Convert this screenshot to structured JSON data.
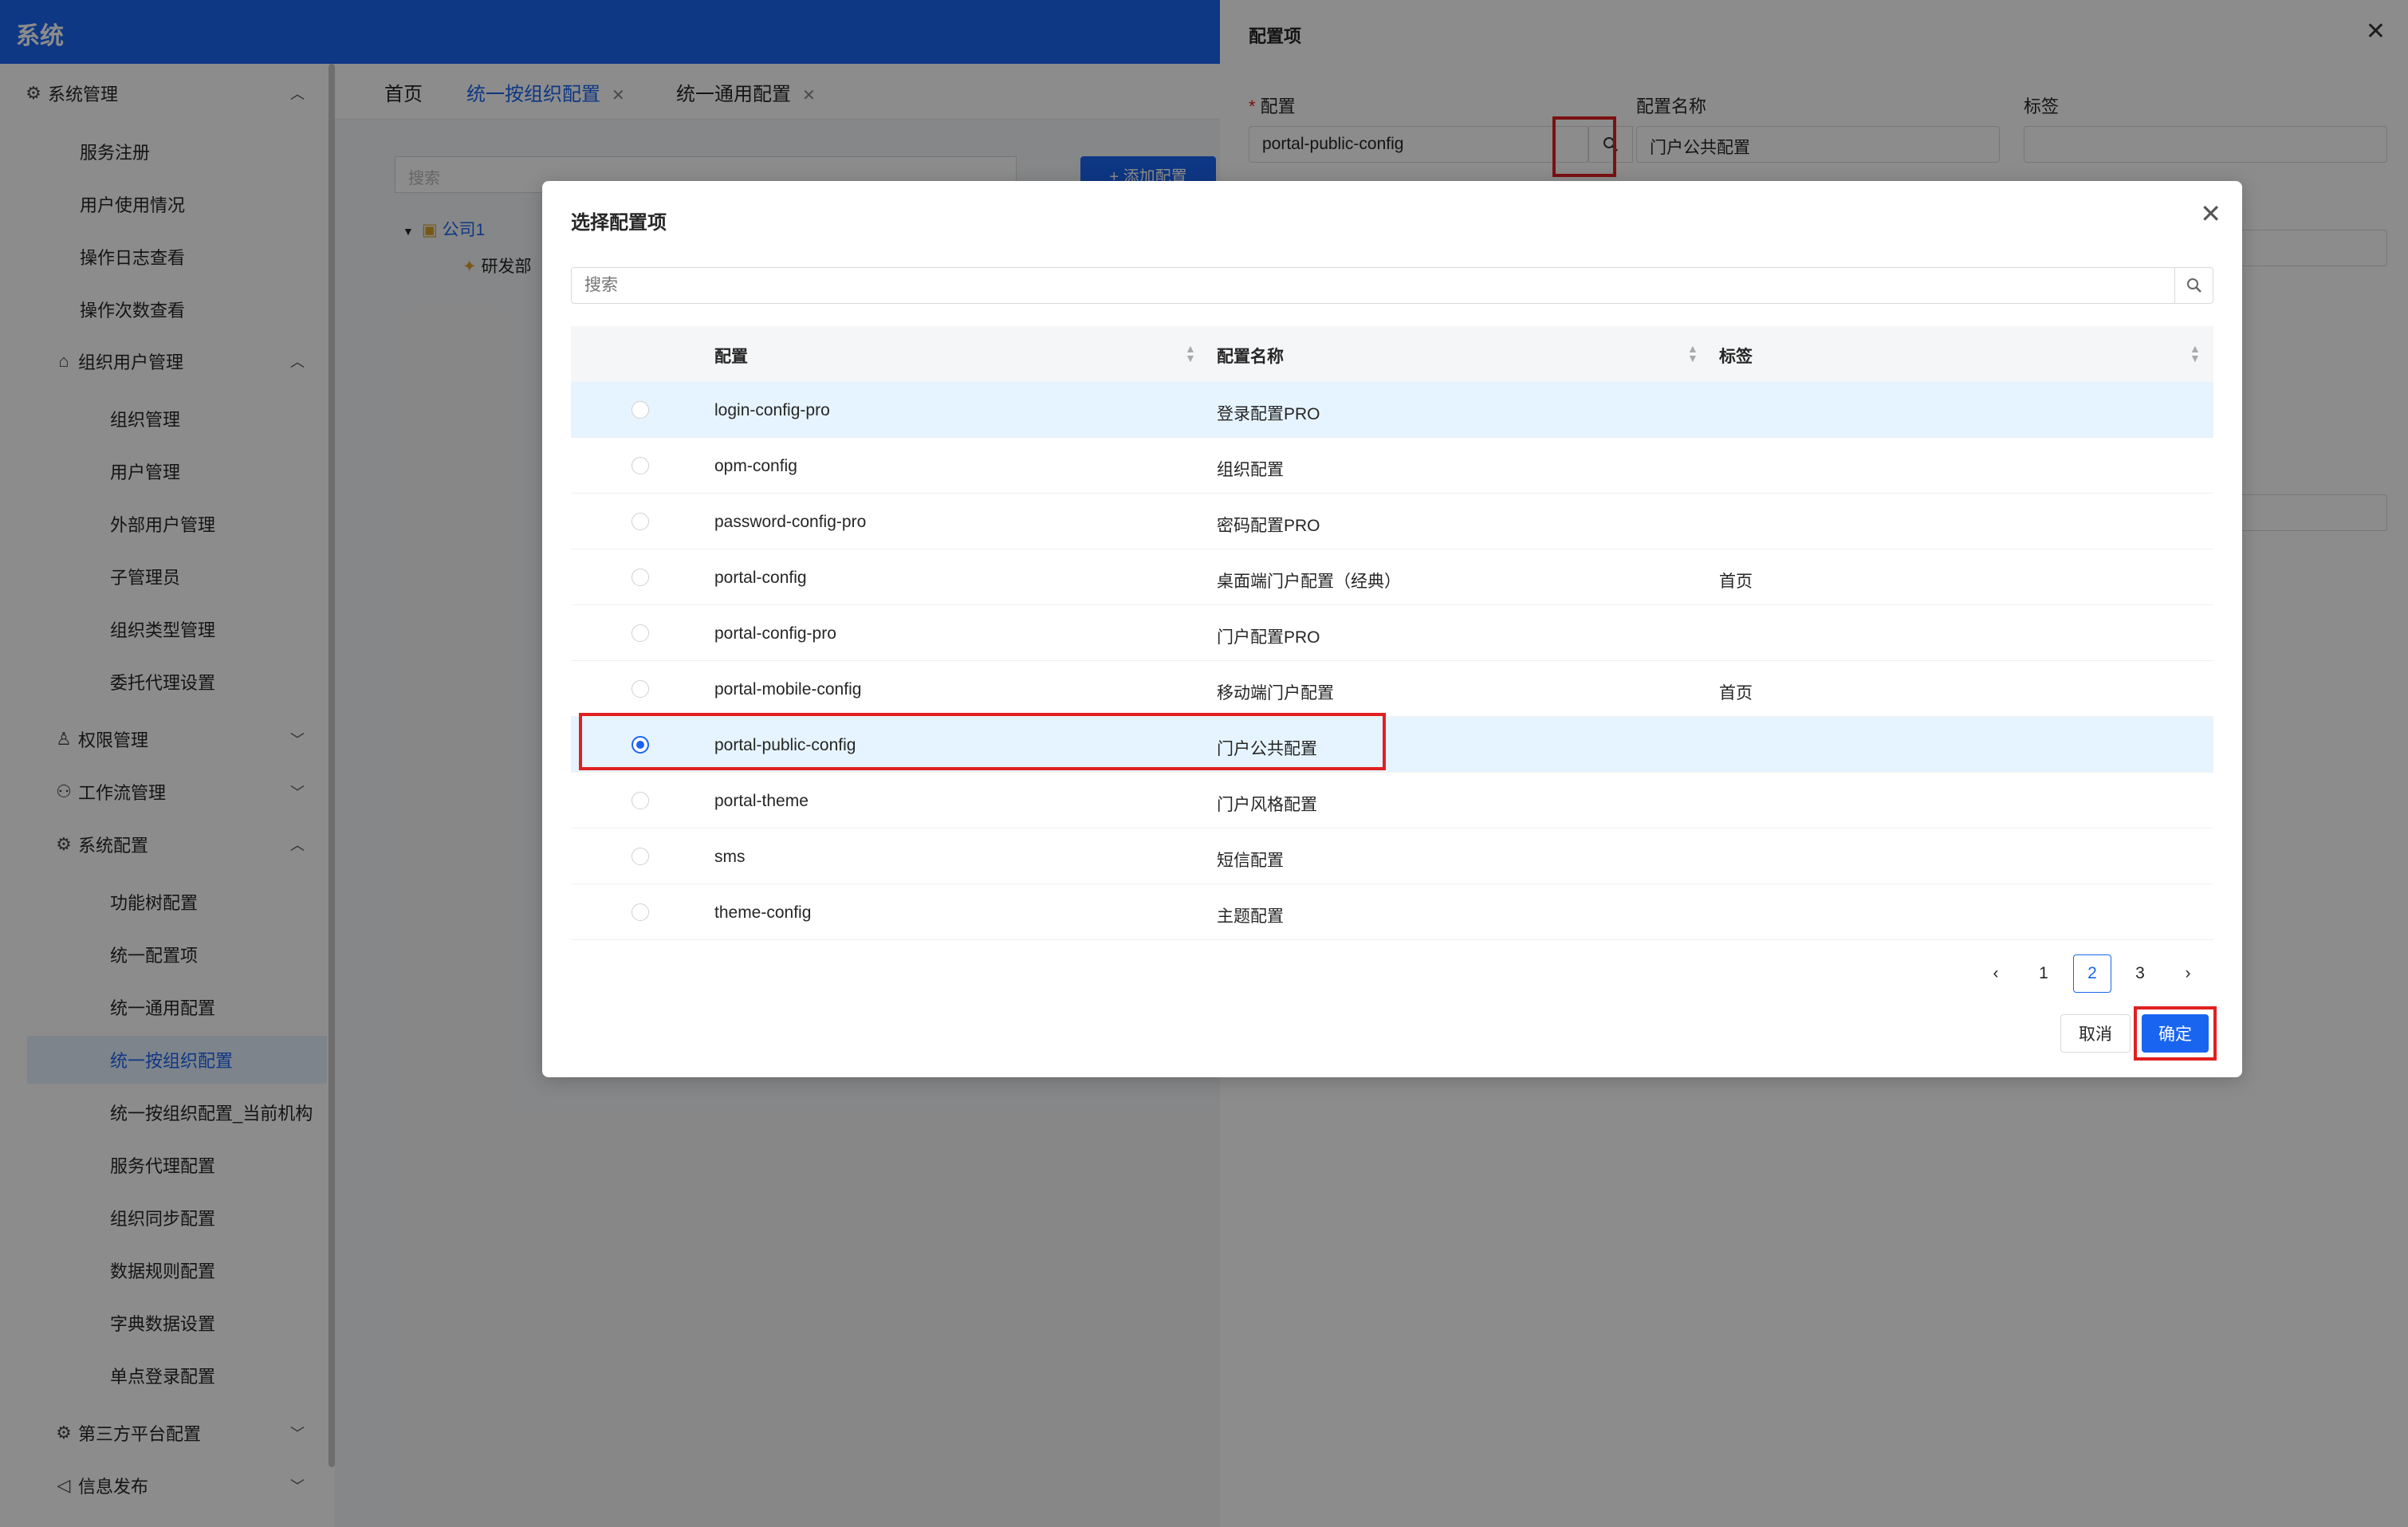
{
  "app": {
    "title": "系统"
  },
  "sidebar": {
    "items": [
      {
        "label": "系统管理",
        "level": 0,
        "icon": "gear-icon",
        "expanded": true
      },
      {
        "label": "服务注册",
        "level": 1
      },
      {
        "label": "用户使用情况",
        "level": 1
      },
      {
        "label": "操作日志查看",
        "level": 1
      },
      {
        "label": "操作次数查看",
        "level": 1
      },
      {
        "label": "组织用户管理",
        "level": 1,
        "icon": "bank-icon",
        "expanded": true
      },
      {
        "label": "组织管理",
        "level": 2
      },
      {
        "label": "用户管理",
        "level": 2
      },
      {
        "label": "外部用户管理",
        "level": 2
      },
      {
        "label": "子管理员",
        "level": 2
      },
      {
        "label": "组织类型管理",
        "level": 2
      },
      {
        "label": "委托代理设置",
        "level": 2
      },
      {
        "label": "权限管理",
        "level": 1,
        "icon": "user-icon",
        "expanded": false
      },
      {
        "label": "工作流管理",
        "level": 1,
        "icon": "flow-icon",
        "expanded": false
      },
      {
        "label": "系统配置",
        "level": 1,
        "icon": "gear-icon",
        "expanded": true
      },
      {
        "label": "功能树配置",
        "level": 2
      },
      {
        "label": "统一配置项",
        "level": 2
      },
      {
        "label": "统一通用配置",
        "level": 2
      },
      {
        "label": "统一按组织配置",
        "level": 2,
        "active": true
      },
      {
        "label": "统一按组织配置_当前机构",
        "level": 2
      },
      {
        "label": "服务代理配置",
        "level": 2
      },
      {
        "label": "组织同步配置",
        "level": 2
      },
      {
        "label": "数据规则配置",
        "level": 2
      },
      {
        "label": "字典数据设置",
        "level": 2
      },
      {
        "label": "单点登录配置",
        "level": 2
      },
      {
        "label": "第三方平台配置",
        "level": 1,
        "icon": "gear-icon",
        "expanded": false
      },
      {
        "label": "信息发布",
        "level": 1,
        "icon": "megaphone-icon",
        "expanded": false
      }
    ]
  },
  "tabs": [
    {
      "label": "首页",
      "closable": false
    },
    {
      "label": "统一按组织配置",
      "closable": true,
      "active": true
    },
    {
      "label": "统一通用配置",
      "closable": true
    }
  ],
  "content": {
    "search_placeholder": "搜索",
    "add_button": "+ 添加配置",
    "tree": [
      {
        "label": "公司1"
      },
      {
        "label": "研发部"
      }
    ]
  },
  "drawer": {
    "title": "配置项",
    "fields": {
      "config_label": "配置",
      "config_value": "portal-public-config",
      "name_label": "配置名称",
      "name_value": "门户公共配置",
      "tag_label": "标签",
      "tag_value": ""
    }
  },
  "modal": {
    "title": "选择配置项",
    "search_placeholder": "搜索",
    "columns": [
      "配置",
      "配置名称",
      "标签"
    ],
    "rows": [
      {
        "config": "login-config-pro",
        "name": "登录配置PRO",
        "tag": "",
        "selected": false
      },
      {
        "config": "opm-config",
        "name": "组织配置",
        "tag": "",
        "selected": false
      },
      {
        "config": "password-config-pro",
        "name": "密码配置PRO",
        "tag": "",
        "selected": false
      },
      {
        "config": "portal-config",
        "name": "桌面端门户配置（经典）",
        "tag": "首页",
        "selected": false
      },
      {
        "config": "portal-config-pro",
        "name": "门户配置PRO",
        "tag": "",
        "selected": false
      },
      {
        "config": "portal-mobile-config",
        "name": "移动端门户配置",
        "tag": "首页",
        "selected": false
      },
      {
        "config": "portal-public-config",
        "name": "门户公共配置",
        "tag": "",
        "selected": true
      },
      {
        "config": "portal-theme",
        "name": "门户风格配置",
        "tag": "",
        "selected": false
      },
      {
        "config": "sms",
        "name": "短信配置",
        "tag": "",
        "selected": false
      },
      {
        "config": "theme-config",
        "name": "主题配置",
        "tag": "",
        "selected": false
      }
    ],
    "pagination": {
      "pages": [
        "1",
        "2",
        "3"
      ],
      "current": "2"
    },
    "cancel_label": "取消",
    "ok_label": "确定"
  },
  "colors": {
    "primary": "#1a65f0",
    "highlight_box": "#e02020",
    "row_hover": "#e6f4ff"
  }
}
